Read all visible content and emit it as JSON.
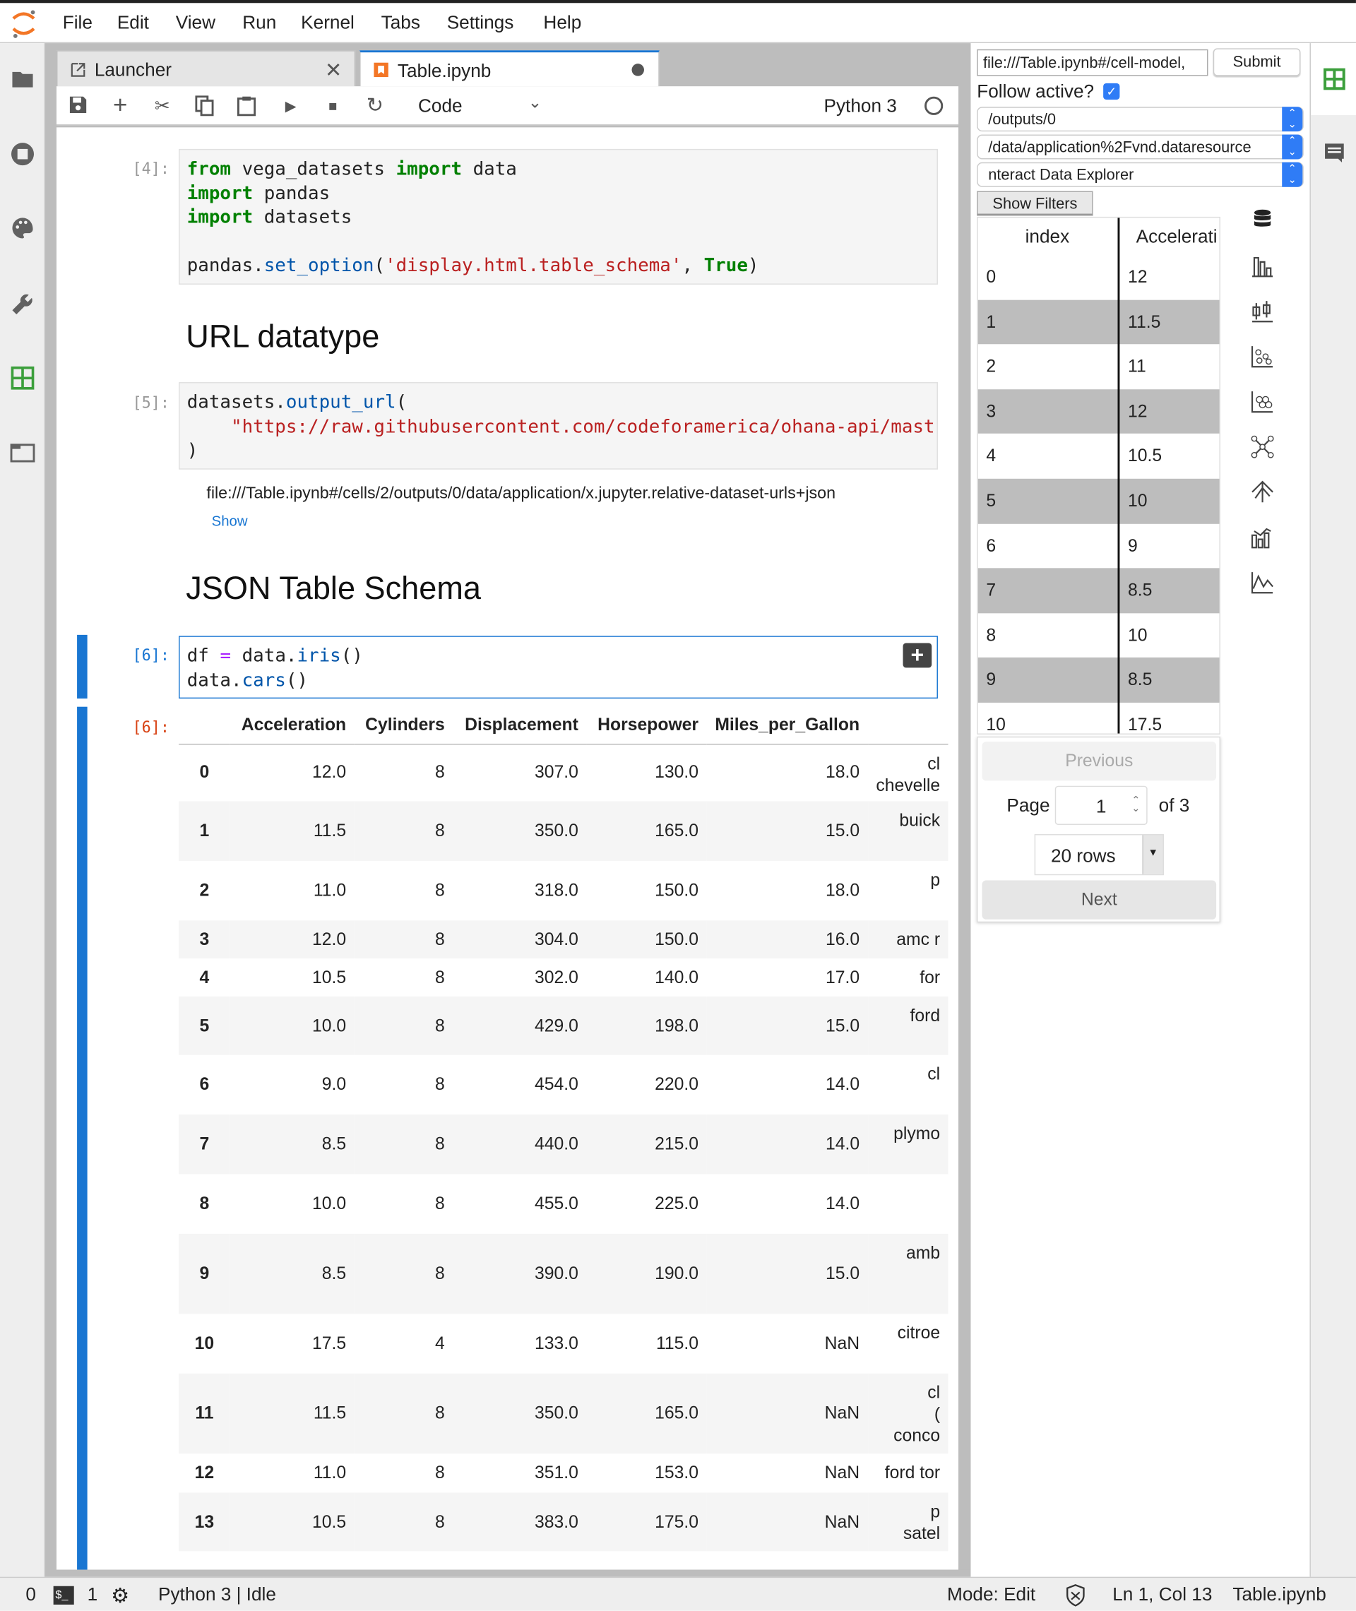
{
  "menu": [
    "File",
    "Edit",
    "View",
    "Run",
    "Kernel",
    "Tabs",
    "Settings",
    "Help"
  ],
  "tabs": [
    {
      "label": "Launcher"
    },
    {
      "label": "Table.ipynb"
    }
  ],
  "toolbar": {
    "cell_type": "Code",
    "kernel": "Python 3"
  },
  "cells": {
    "c4": {
      "prompt": "[4]:",
      "lines": [
        [
          [
            "from",
            "kw"
          ],
          [
            " vega_datasets ",
            ""
          ],
          [
            "import",
            "kw"
          ],
          [
            " data",
            ""
          ]
        ],
        [
          [
            "import",
            "kw"
          ],
          [
            " pandas",
            ""
          ]
        ],
        [
          [
            "import",
            "kw"
          ],
          [
            " datasets",
            ""
          ]
        ],
        [],
        [
          [
            "pandas.",
            ""
          ],
          [
            "set_option",
            "fn"
          ],
          [
            "(",
            ""
          ],
          [
            "'display.html.table_schema'",
            "st"
          ],
          [
            ", ",
            ""
          ],
          [
            "True",
            "kw"
          ],
          [
            ")",
            ""
          ]
        ]
      ]
    },
    "h_url": "URL datatype",
    "c5": {
      "prompt": "[5]:",
      "lines": [
        [
          [
            "datasets.",
            ""
          ],
          [
            "output_url",
            "fn"
          ],
          [
            "(",
            ""
          ]
        ],
        [
          [
            "    ",
            ""
          ],
          [
            "\"https://raw.githubusercontent.com/codeforamerica/ohana-api/mast",
            "st"
          ]
        ],
        [
          [
            ")",
            ""
          ]
        ]
      ],
      "output": "file:///Table.ipynb#/cells/2/outputs/0/data/application/x.jupyter.relative-dataset-urls+json",
      "show": "Show"
    },
    "h_json": "JSON Table Schema",
    "c6": {
      "prompt": "[6]:",
      "out_prompt": "[6]:",
      "lines": [
        [
          [
            "df ",
            ""
          ],
          [
            "=",
            "op"
          ],
          [
            " data.",
            ""
          ],
          [
            "iris",
            "fn"
          ],
          [
            "()",
            ""
          ]
        ],
        [
          [
            "data.",
            ""
          ],
          [
            "cars",
            "fn"
          ],
          [
            "()",
            ""
          ]
        ]
      ]
    }
  },
  "output_table": {
    "columns": [
      "",
      "Acceleration",
      "Cylinders",
      "Displacement",
      "Horsepower",
      "Miles_per_Gallon",
      ""
    ],
    "rows": [
      [
        "0",
        "12.0",
        "8",
        "307.0",
        "130.0",
        "18.0",
        "cl\nchevelle"
      ],
      [
        "1",
        "11.5",
        "8",
        "350.0",
        "165.0",
        "15.0",
        "buick"
      ],
      [
        "2",
        "11.0",
        "8",
        "318.0",
        "150.0",
        "18.0",
        "p"
      ],
      [
        "3",
        "12.0",
        "8",
        "304.0",
        "150.0",
        "16.0",
        "amc r"
      ],
      [
        "4",
        "10.5",
        "8",
        "302.0",
        "140.0",
        "17.0",
        "for"
      ],
      [
        "5",
        "10.0",
        "8",
        "429.0",
        "198.0",
        "15.0",
        "ford"
      ],
      [
        "6",
        "9.0",
        "8",
        "454.0",
        "220.0",
        "14.0",
        "cl"
      ],
      [
        "7",
        "8.5",
        "8",
        "440.0",
        "215.0",
        "14.0",
        "plymo"
      ],
      [
        "8",
        "10.0",
        "8",
        "455.0",
        "225.0",
        "14.0",
        ""
      ],
      [
        "9",
        "8.5",
        "8",
        "390.0",
        "190.0",
        "15.0",
        "amb"
      ],
      [
        "10",
        "17.5",
        "4",
        "133.0",
        "115.0",
        "NaN",
        "citroe"
      ],
      [
        "11",
        "11.5",
        "8",
        "350.0",
        "165.0",
        "NaN",
        "cl\n(\nconco"
      ],
      [
        "12",
        "11.0",
        "8",
        "351.0",
        "153.0",
        "NaN",
        "ford tor"
      ],
      [
        "13",
        "10.5",
        "8",
        "383.0",
        "175.0",
        "NaN",
        "p\nsatel"
      ]
    ]
  },
  "panel": {
    "url": "file:///Table.ipynb#/cell-model,",
    "submit": "Submit",
    "follow_label": "Follow active?",
    "follow_checked": true,
    "selects": [
      "/outputs/0",
      "/data/application%2Fvnd.dataresource",
      "nteract Data Explorer"
    ],
    "show_filters": "Show Filters",
    "table_headers": [
      "index",
      "Accelerati"
    ],
    "table_rows": [
      [
        "0",
        "12"
      ],
      [
        "1",
        "11.5"
      ],
      [
        "2",
        "11"
      ],
      [
        "3",
        "12"
      ],
      [
        "4",
        "10.5"
      ],
      [
        "5",
        "10"
      ],
      [
        "6",
        "9"
      ],
      [
        "7",
        "8.5"
      ],
      [
        "8",
        "10"
      ],
      [
        "9",
        "8.5"
      ],
      [
        "10",
        "17.5"
      ]
    ],
    "previous": "Previous",
    "page_label": "Page",
    "page_value": "1",
    "of_label": "of 3",
    "rows_select": "20 rows",
    "next": "Next",
    "accent": "#2f7cf6"
  },
  "status": {
    "terminals": "0",
    "kernels": "1",
    "kernel_state": "Python 3 | Idle",
    "mode": "Mode: Edit",
    "position": "Ln 1, Col 13",
    "filename": "Table.ipynb"
  }
}
